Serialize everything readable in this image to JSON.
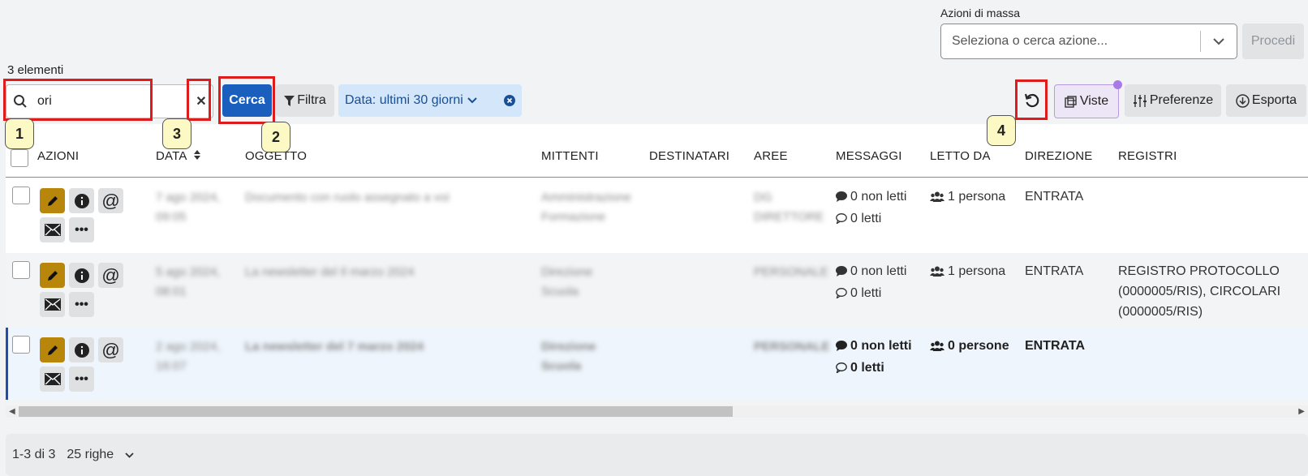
{
  "mass_actions": {
    "label": "Azioni di massa",
    "placeholder": "Seleziona o cerca azione...",
    "proceed": "Procedi"
  },
  "count_label": "3 elementi",
  "search": {
    "value": "ori"
  },
  "toolbar": {
    "search_button": "Cerca",
    "filter_button": "Filtra",
    "date_chip": "Data: ultimi 30 giorni",
    "views_button": "Viste",
    "preferences_button": "Preferenze",
    "export_button": "Esporta"
  },
  "annotations": [
    "1",
    "2",
    "3",
    "4"
  ],
  "columns": [
    "AZIONI",
    "DATA",
    "OGGETTO",
    "MITTENTI",
    "DESTINATARI",
    "AREE",
    "MESSAGGI",
    "LETTO DA",
    "DIREZIONE",
    "REGISTRI"
  ],
  "rows": [
    {
      "date_blur": [
        "7 ago 2024,",
        "09:05"
      ],
      "subject_blur": "Documento con ruolo assegnato a voi",
      "senders_blur": [
        "Amministrazione",
        "Formazione"
      ],
      "areas_blur": [
        "DG",
        "DIRETTORE"
      ],
      "unread": "0 non letti",
      "read": "0 letti",
      "read_by": "1 persona",
      "direction": "ENTRATA",
      "registers": [
        "",
        "",
        ""
      ]
    },
    {
      "date_blur": [
        "5 ago 2024,",
        "08:01"
      ],
      "subject_blur": "La newsletter del Il marzo 2024",
      "senders_blur": [
        "Direzione",
        "Scuola"
      ],
      "areas_blur": [
        "PERSONALE"
      ],
      "unread": "0 non letti",
      "read": "0 letti",
      "read_by": "1 persona",
      "direction": "ENTRATA",
      "registers": [
        "REGISTRO PROTOCOLLO",
        "(0000005/RIS), CIRCOLARI",
        "(0000005/RIS)"
      ]
    },
    {
      "date_blur": [
        "2 ago 2024,",
        "16:07"
      ],
      "subject_blur": "La newsletter del 7 marzo 2024",
      "senders_blur": [
        "Direzione",
        "Scuola"
      ],
      "areas_blur": [
        "PERSONALE"
      ],
      "unread": "0 non letti",
      "read": "0 letti",
      "read_by": "0 persone",
      "direction": "ENTRATA",
      "registers": [
        "",
        "",
        ""
      ]
    }
  ],
  "footer": {
    "range": "1-3 di 3",
    "rows_per_page": "25 righe"
  },
  "colors": {
    "primary": "#1a5fbd",
    "edit": "#b8860b",
    "annotation_border": "#e01b1b",
    "annotation_tag": "#fdf9c4",
    "selected_row_bar": "#1f4fa8"
  }
}
